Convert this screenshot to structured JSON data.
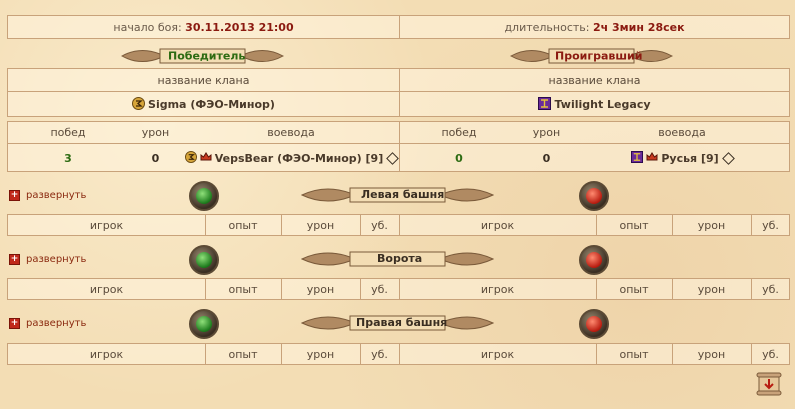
{
  "header": {
    "start_label": "начало боя:",
    "start_value": "30.11.2013 21:00",
    "duration_label": "длительность:",
    "duration_value": "2ч 3мин 28сек"
  },
  "winner": {
    "title": "Победитель",
    "clan_col": "название клана",
    "clan_name": "Sigma (ФЭО-Минор)",
    "cols": [
      "побед",
      "урон",
      "воевода"
    ],
    "wins": "3",
    "damage": "0",
    "leader": "VepsBear (ФЭО-Минор) [9]"
  },
  "loser": {
    "title": "Проигравший",
    "clan_col": "название клана",
    "clan_name": "Twilight Legacy",
    "cols": [
      "побед",
      "урон",
      "воевода"
    ],
    "wins": "0",
    "damage": "0",
    "leader": "Русья [9]"
  },
  "expand_label": "развернуть",
  "table_cols": [
    "игрок",
    "опыт",
    "урон",
    "уб."
  ],
  "towers": [
    {
      "title": "Левая башня"
    },
    {
      "title": "Ворота"
    },
    {
      "title": "Правая башня"
    }
  ],
  "colors": {
    "win_green": "#2d6b12",
    "lose_red": "#8b1a10",
    "border": "#c8a27a"
  },
  "icons": {
    "winner_clan": "sigma-clan-icon",
    "loser_clan": "twilight-clan-icon",
    "scroll": "scroll-icon"
  }
}
